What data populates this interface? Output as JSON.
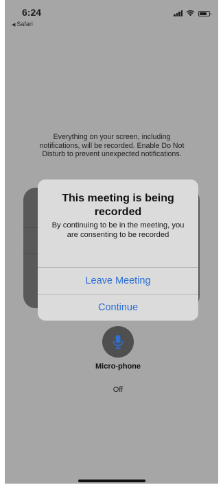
{
  "status_bar": {
    "time": "6:24",
    "back_app": "Safari",
    "signal_icon": "cellular-signal-icon",
    "wifi_icon": "wifi-icon",
    "battery_icon": "battery-icon"
  },
  "recording_notice": "Everything on your screen, including notifications, will be recorded. Enable Do Not Disturb to prevent unexpected notifications.",
  "alert": {
    "title": "This meeting is being recorded",
    "message": "By continuing to be in the meeting, you are consenting to be recorded",
    "buttons": [
      {
        "label": "Leave Meeting"
      },
      {
        "label": "Continue"
      }
    ]
  },
  "microphone": {
    "icon": "microphone-icon",
    "label": "Micro-phone",
    "state": "Off"
  },
  "colors": {
    "accent": "#2b6fd6",
    "overlay": "#a6a6a6"
  }
}
